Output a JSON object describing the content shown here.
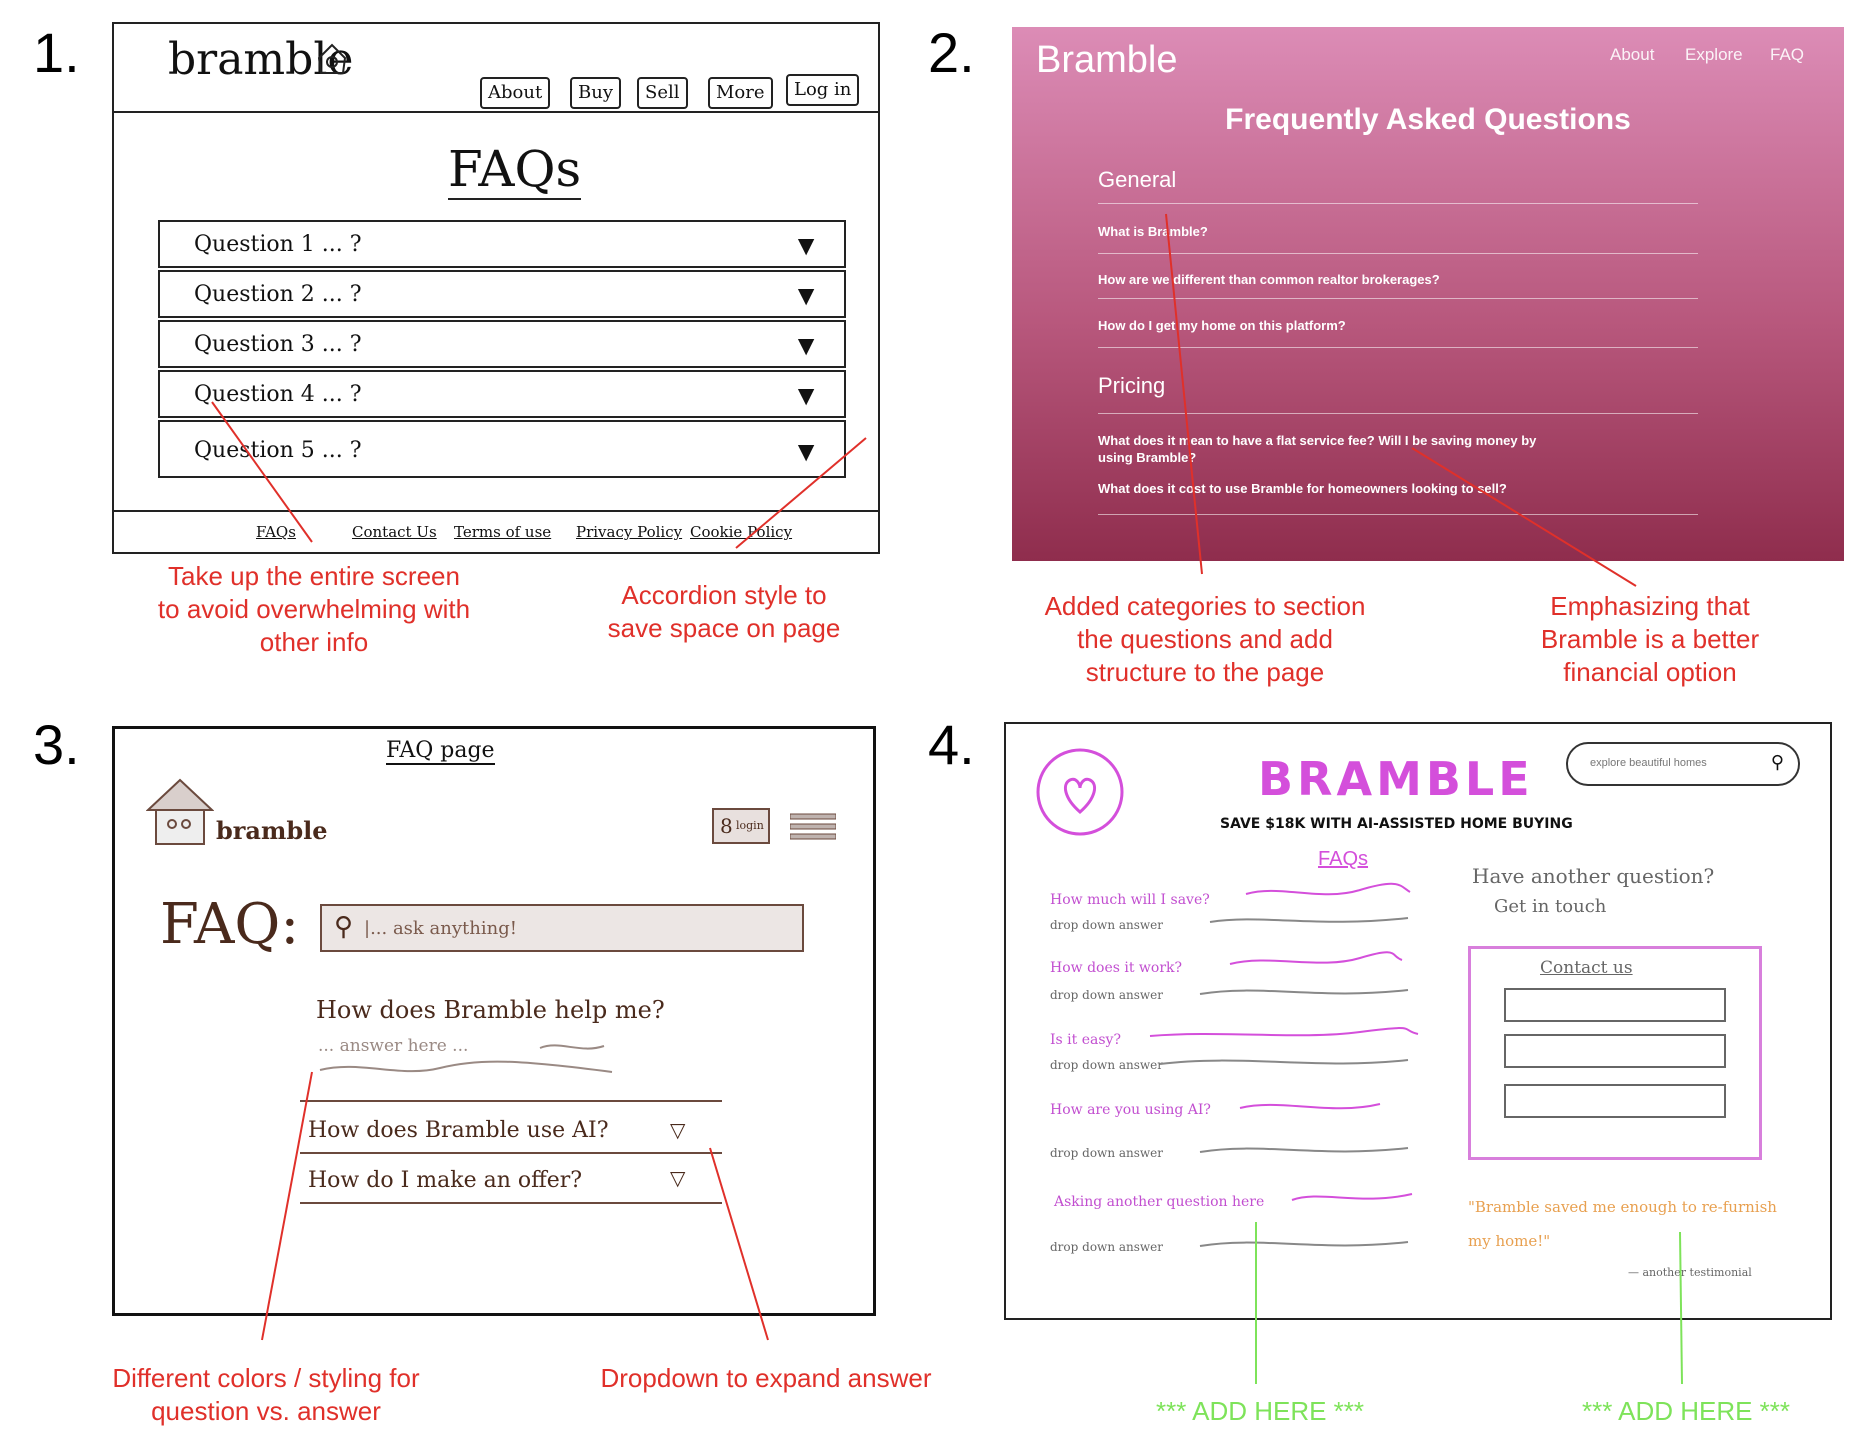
{
  "numbers": [
    "1.",
    "2.",
    "3.",
    "4."
  ],
  "panel1": {
    "logo": "bramble",
    "nav": [
      "About",
      "Buy",
      "Sell",
      "More",
      "Log in"
    ],
    "title": "FAQs",
    "questions": [
      "Question 1 ... ?",
      "Question 2 ... ?",
      "Question 3 ... ?",
      "Question 4 ... ?",
      "Question 5 ... ?"
    ],
    "arrow": "▼",
    "footer": [
      "FAQs",
      "Contact Us",
      "Terms of use",
      "Privacy Policy",
      "Cookie Policy"
    ],
    "annotation_left": "Take up the entire screen to avoid overwhelming with other info",
    "annotation_right": "Accordion style to save space on page"
  },
  "panel2": {
    "logo": "Bramble",
    "nav": [
      "About",
      "Explore",
      "FAQ"
    ],
    "title": "Frequently Asked Questions",
    "categories": [
      {
        "name": "General",
        "questions": [
          "What is Bramble?",
          "How are we different than common realtor brokerages?",
          "How do I get my home on this platform?"
        ]
      },
      {
        "name": "Pricing",
        "questions": [
          "What does it mean to have a flat service fee? Will I be saving money by using Bramble?",
          "What does it cost to use Bramble for homeowners looking to sell?"
        ]
      }
    ],
    "annotation_left": "Added categories to section the questions and add structure to the page",
    "annotation_right": "Emphasizing that Bramble is a better financial option"
  },
  "panel3": {
    "heading": "FAQ page",
    "logo": "bramble",
    "login": "login",
    "faq_label": "FAQ:",
    "search_placeholder": "|... ask anything!",
    "open_question": "How does Bramble help me?",
    "open_answer": "... answer here ...",
    "questions": [
      "How does Bramble use AI?",
      "How do I make an offer?"
    ],
    "annotation_left": "Different colors / styling for question vs. answer",
    "annotation_right": "Dropdown to expand answer"
  },
  "panel4": {
    "logo": "BRAMBLE",
    "tagline": "SAVE $18K WITH AI-ASSISTED HOME BUYING",
    "search_placeholder": "explore beautiful homes",
    "faqs_title": "FAQs",
    "questions": [
      "How much will I save?",
      "How does it work?",
      "Is it easy?",
      "How are you using AI?",
      "Asking another question here"
    ],
    "answer": "drop down answer",
    "aside_heading": "Have another question?",
    "aside_sub": "Get in touch",
    "contact_title": "Contact us",
    "testimonial": "\"Bramble saved me enough to re-furnish my home!\"",
    "testimonial_author": "— another testimonial",
    "add_here": [
      "*** ADD HERE ***",
      "*** ADD HERE ***"
    ]
  }
}
